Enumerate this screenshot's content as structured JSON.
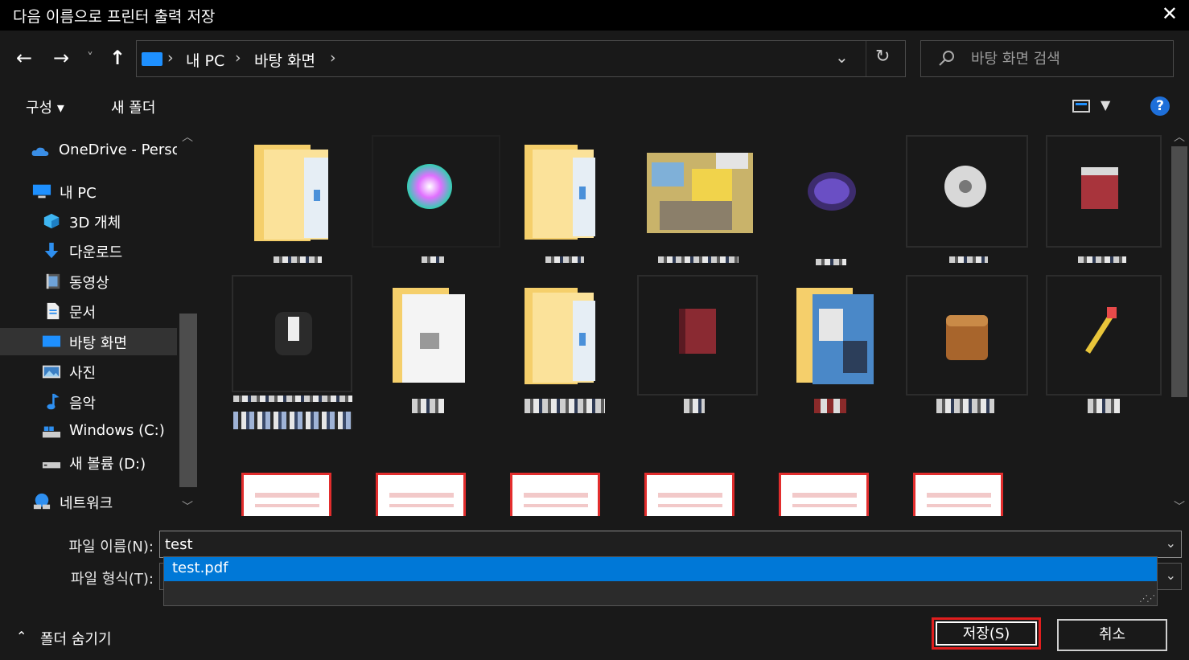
{
  "window": {
    "title": "다음 이름으로 프린터 출력 저장",
    "close_glyph": "✕"
  },
  "nav": {
    "back": "←",
    "forward": "→",
    "recent": "˅",
    "up": "↑"
  },
  "address": {
    "crumbs": [
      "내 PC",
      "바탕 화면"
    ],
    "separator": "›",
    "dropdown_glyph": "⌄",
    "refresh_glyph": "↻"
  },
  "search": {
    "placeholder": "바탕 화면 검색",
    "icon": "search-icon"
  },
  "toolbar": {
    "organize": "구성 ▾",
    "new_folder": "새 폴더",
    "help": "?"
  },
  "sidebar": {
    "items": [
      {
        "label": "OneDrive - Personal",
        "icon": "onedrive-icon"
      },
      {
        "label": "내 PC",
        "icon": "pc-icon"
      },
      {
        "label": "3D 개체",
        "icon": "cube-icon"
      },
      {
        "label": "다운로드",
        "icon": "download-icon"
      },
      {
        "label": "동영상",
        "icon": "video-icon"
      },
      {
        "label": "문서",
        "icon": "document-icon"
      },
      {
        "label": "바탕 화면",
        "icon": "desktop-icon",
        "selected": true
      },
      {
        "label": "사진",
        "icon": "picture-icon"
      },
      {
        "label": "음악",
        "icon": "music-icon"
      },
      {
        "label": "Windows (C:)",
        "icon": "drive-icon"
      },
      {
        "label": "새 볼륨 (D:)",
        "icon": "drive-icon"
      },
      {
        "label": "네트워크",
        "icon": "network-icon"
      }
    ]
  },
  "form": {
    "filename_label": "파일 이름(N):",
    "filename_value": "test",
    "filetype_label": "파일 형식(T):",
    "suggestion": "test.pdf",
    "dropdown_glyph": "⌄"
  },
  "footer": {
    "hide_folders": "폴더 숨기기",
    "hide_glyph": "⌃",
    "save": "저장(S)",
    "cancel": "취소"
  },
  "colors": {
    "accent": "#0078d7",
    "highlight_border": "#e01e1e",
    "folder": "#f5cf6b"
  }
}
